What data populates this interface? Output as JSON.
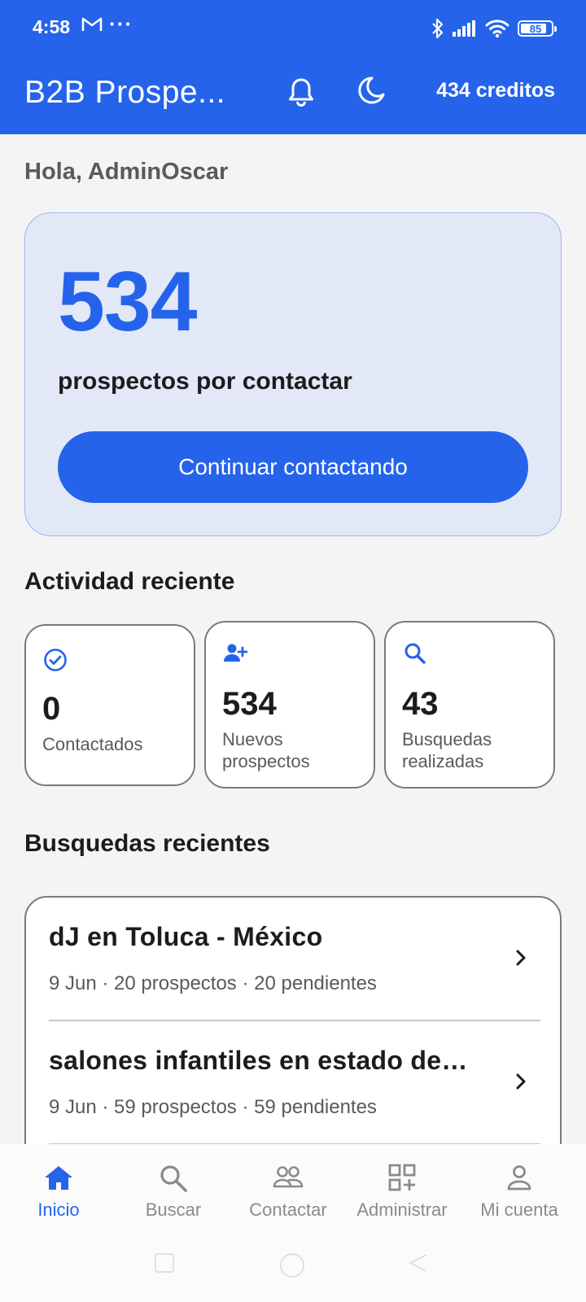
{
  "status": {
    "time": "4:58",
    "battery": "85",
    "battery_level": 0.85
  },
  "appbar": {
    "title": "B2B Prospe...",
    "credits": "434 creditos"
  },
  "greeting": "Hola, AdminOscar",
  "hero": {
    "count": "534",
    "subtitle": "prospectos por contactar",
    "cta_label": "Continuar contactando"
  },
  "activity": {
    "title": "Actividad reciente",
    "cards": [
      {
        "icon": "check-circle-icon",
        "value": "0",
        "label": "Contactados"
      },
      {
        "icon": "person-add-icon",
        "value": "534",
        "label": "Nuevos prospectos"
      },
      {
        "icon": "search-icon",
        "value": "43",
        "label": "Busquedas realizadas"
      }
    ]
  },
  "recent_searches": {
    "title": "Busquedas recientes",
    "items": [
      {
        "name": "dJ en Toluca - México",
        "meta": "9 Jun · 20 prospectos · 20 pendientes"
      },
      {
        "name": "salones infantiles en estado de…",
        "meta": "9 Jun · 59 prospectos · 59 pendientes"
      }
    ]
  },
  "bottom_nav": [
    {
      "icon": "home-icon",
      "label": "Inicio",
      "active": true
    },
    {
      "icon": "search-icon",
      "label": "Buscar",
      "active": false
    },
    {
      "icon": "people-icon",
      "label": "Contactar",
      "active": false
    },
    {
      "icon": "grid-add-icon",
      "label": "Administrar",
      "active": false
    },
    {
      "icon": "person-icon",
      "label": "Mi cuenta",
      "active": false
    }
  ],
  "colors": {
    "primary": "#2563eb",
    "hero_bg": "#e3e8f7",
    "page_bg": "#f4f4f5"
  }
}
